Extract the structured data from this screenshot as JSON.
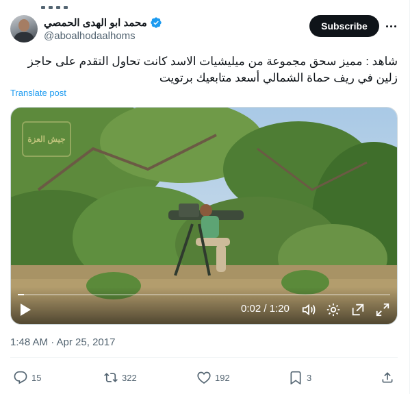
{
  "author": {
    "name": "محمد ابو الهدى الحمصي",
    "handle": "@aboalhodaalhoms",
    "verified": true
  },
  "subscribe_label": "Subscribe",
  "post_text": "شاهد : مميز سحق مجموعة من ميليشيات الاسد كانت تحاول التقدم على حاجز زلين في ريف حماة الشمالي أسعد متابعيك برتويت",
  "translate_label": "Translate post",
  "video": {
    "watermark": "جيش العزة",
    "time_display": "0:02 / 1:20",
    "progress_fraction": 0.017
  },
  "timestamp": "1:48 AM · Apr 25, 2017",
  "actions": {
    "replies": "15",
    "reposts": "322",
    "likes": "192",
    "bookmarks": "3"
  },
  "colors": {
    "accent": "#1d9bf0",
    "text": "#0f1419",
    "secondary": "#536471",
    "subscribe_bg": "#0f1419"
  },
  "icons": [
    "verified-badge-icon",
    "more-icon",
    "play-icon",
    "volume-icon",
    "settings-icon",
    "pop-out-icon",
    "fullscreen-icon",
    "reply-icon",
    "repost-icon",
    "like-icon",
    "bookmark-icon",
    "share-icon"
  ]
}
